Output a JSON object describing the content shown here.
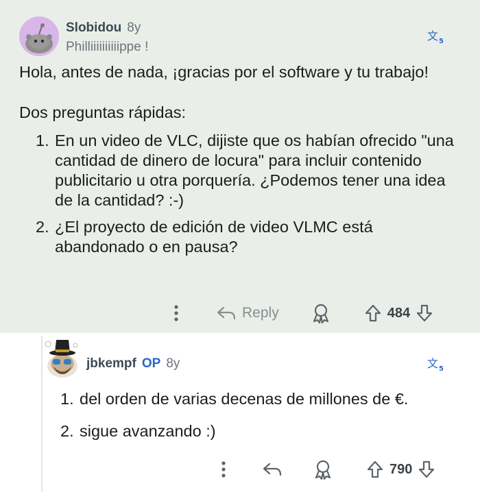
{
  "comments": [
    {
      "author": "Slobidou",
      "age": "8y",
      "flair": "Philliiiiiiiiiippe !",
      "intro": "Hola, antes de nada, ¡gracias por el software y tu trabajo!",
      "lead": "Dos preguntas rápidas:",
      "items": [
        {
          "num": "1.",
          "text": "En un video de VLC, dijiste que os habían ofrecido \"una cantidad de dinero de locura\" para incluir contenido publicitario u otra porquería. ¿Podemos tener una idea de la cantidad? :-)"
        },
        {
          "num": "2.",
          "text": "¿El proyecto de edición de video VLMC está abandonado o en pausa?"
        }
      ],
      "reply_label": "Reply",
      "score": "484"
    },
    {
      "author": "jbkempf",
      "op_label": "OP",
      "age": "8y",
      "items": [
        {
          "num": "1.",
          "text": "del orden de varias decenas de millones de €."
        },
        {
          "num": "2.",
          "text": "sigue avanzando :)"
        }
      ],
      "score": "790"
    }
  ],
  "icons": {
    "more": "more-options-icon",
    "reply": "reply-arrow-icon",
    "award": "award-icon",
    "upvote": "upvote-arrow-icon",
    "downvote": "downvote-arrow-icon",
    "translate": "translate-icon"
  },
  "colors": {
    "highlight_background": "#e9efe8",
    "op_blue": "#2a66c9",
    "avatar_purple": "#d9b6ea"
  }
}
